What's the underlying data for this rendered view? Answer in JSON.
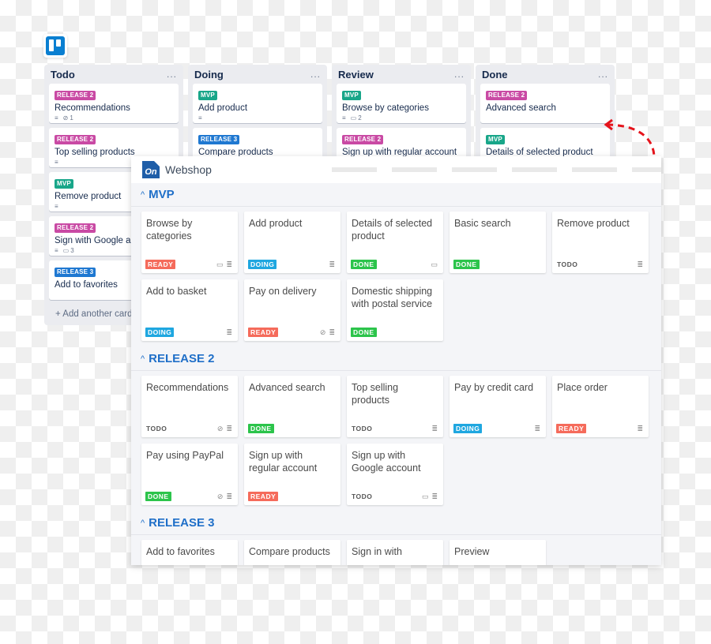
{
  "colors": {
    "release2": "#c94aa4",
    "release3": "#1f78d1",
    "mvp": "#18a689",
    "ready": "#f56b5b",
    "doing": "#1fa7e0",
    "done": "#2cc44b",
    "todo": "#555555"
  },
  "trello": {
    "logo": "trello-icon",
    "lists": [
      {
        "title": "Todo",
        "menu": "...",
        "cards": [
          {
            "label": "RELEASE 2",
            "label_type": "release2",
            "title": "Recommendations",
            "badges": {
              "description": true,
              "attachments": "1"
            }
          },
          {
            "label": "RELEASE 2",
            "label_type": "release2",
            "title": "Top selling products",
            "badges": {
              "description": true
            }
          },
          {
            "label": "MVP",
            "label_type": "mvp",
            "title": "Remove product",
            "badges": {
              "description": true
            }
          },
          {
            "label": "RELEASE 2",
            "label_type": "release2",
            "title": "Sign with Google account",
            "badges": {
              "description": true,
              "comments": "3"
            }
          },
          {
            "label": "RELEASE 3",
            "label_type": "release3",
            "title": "Add to favorites",
            "badges": {}
          }
        ],
        "add_card": "+ Add another card"
      },
      {
        "title": "Doing",
        "menu": "...",
        "cards": [
          {
            "label": "MVP",
            "label_type": "mvp",
            "title": "Add product",
            "badges": {
              "description": true
            }
          },
          {
            "label": "RELEASE 3",
            "label_type": "release3",
            "title": "Compare products",
            "badges": {}
          }
        ]
      },
      {
        "title": "Review",
        "menu": "...",
        "cards": [
          {
            "label": "MVP",
            "label_type": "mvp",
            "title": "Browse by categories",
            "badges": {
              "description": true,
              "comments": "2"
            }
          },
          {
            "label": "RELEASE 2",
            "label_type": "release2",
            "title": "Sign up with regular account",
            "badges": {}
          }
        ]
      },
      {
        "title": "Done",
        "menu": "...",
        "cards": [
          {
            "label": "RELEASE 2",
            "label_type": "release2",
            "title": "Advanced search",
            "badges": {}
          },
          {
            "label": "MVP",
            "label_type": "mvp",
            "title": "Details of selected product",
            "badges": {}
          }
        ]
      }
    ]
  },
  "webshop": {
    "logo_text": "On",
    "title": "Webshop",
    "sections": [
      {
        "title": "MVP",
        "chevron": "^",
        "cards": [
          {
            "title": "Browse by categories",
            "status": "READY",
            "status_type": "ready",
            "icons": [
              "comment",
              "description"
            ]
          },
          {
            "title": "Add product",
            "status": "DOING",
            "status_type": "doing",
            "icons": [
              "description"
            ]
          },
          {
            "title": "Details of selected product",
            "status": "DONE",
            "status_type": "done",
            "icons": [
              "comment"
            ]
          },
          {
            "title": "Basic search",
            "status": "DONE",
            "status_type": "done",
            "icons": []
          },
          {
            "title": "Remove product",
            "status": "TODO",
            "status_type": "todo",
            "icons": [
              "description"
            ]
          },
          {
            "title": "Add to basket",
            "status": "DOING",
            "status_type": "doing",
            "icons": [
              "description"
            ]
          },
          {
            "title": "Pay on delivery",
            "status": "READY",
            "status_type": "ready",
            "icons": [
              "attachment",
              "description"
            ]
          },
          {
            "title": "Domestic shipping with postal service",
            "status": "DONE",
            "status_type": "done",
            "icons": []
          }
        ]
      },
      {
        "title": "RELEASE 2",
        "chevron": "^",
        "cards": [
          {
            "title": "Recommendations",
            "status": "TODO",
            "status_type": "todo",
            "icons": [
              "attachment",
              "description"
            ]
          },
          {
            "title": "Advanced search",
            "status": "DONE",
            "status_type": "done",
            "icons": []
          },
          {
            "title": "Top selling products",
            "status": "TODO",
            "status_type": "todo",
            "icons": [
              "description"
            ]
          },
          {
            "title": "Pay by credit card",
            "status": "DOING",
            "status_type": "doing",
            "icons": [
              "description"
            ]
          },
          {
            "title": "Place order",
            "status": "READY",
            "status_type": "ready",
            "icons": [
              "description"
            ]
          },
          {
            "title": "Pay using PayPal",
            "status": "DONE",
            "status_type": "done",
            "icons": [
              "attachment",
              "description"
            ]
          },
          {
            "title": "Sign up with regular account",
            "status": "READY",
            "status_type": "ready",
            "icons": []
          },
          {
            "title": "Sign up with Google account",
            "status": "TODO",
            "status_type": "todo",
            "icons": [
              "comment",
              "description"
            ]
          }
        ]
      },
      {
        "title": "RELEASE 3",
        "chevron": "^",
        "cards": [
          {
            "title": "Add to favorites"
          },
          {
            "title": "Compare products"
          },
          {
            "title": "Sign in with"
          },
          {
            "title": "Preview"
          }
        ]
      }
    ]
  },
  "icon_glyphs": {
    "description": "≣",
    "comment": "🗩",
    "attachment": "⊘"
  }
}
